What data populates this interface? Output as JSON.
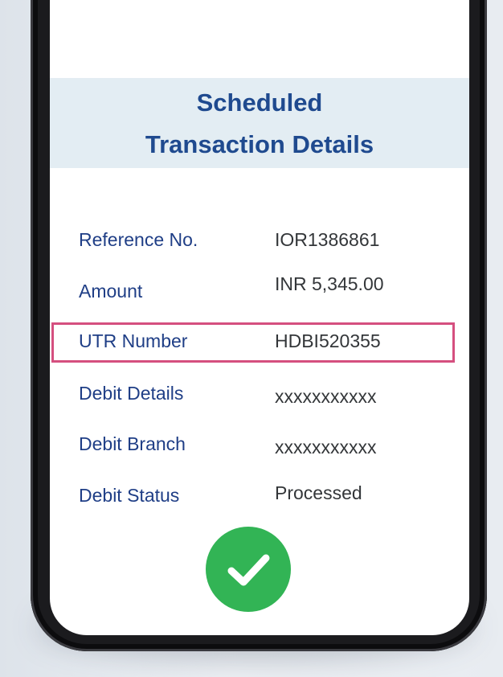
{
  "header": {
    "title_line1": "Scheduled",
    "title_line2": "Transaction Details"
  },
  "details": [
    {
      "label": "Reference No.",
      "value": "IOR1386861"
    },
    {
      "label": "Amount",
      "value": "INR 5,345.00"
    },
    {
      "label": "UTR Number",
      "value": "HDBI520355",
      "highlighted": true
    },
    {
      "label": "Debit Details",
      "value": "xxxxxxxxxxx"
    },
    {
      "label": "Debit Branch",
      "value": "xxxxxxxxxxx"
    },
    {
      "label": "Debit Status",
      "value": "Processed"
    }
  ],
  "status_icon": "checkmark-circle-icon",
  "colors": {
    "label": "#1f3e86",
    "title": "#1f4a8f",
    "highlight_border": "#d54f7f",
    "success": "#32b455",
    "header_band": "#e3edf3"
  }
}
